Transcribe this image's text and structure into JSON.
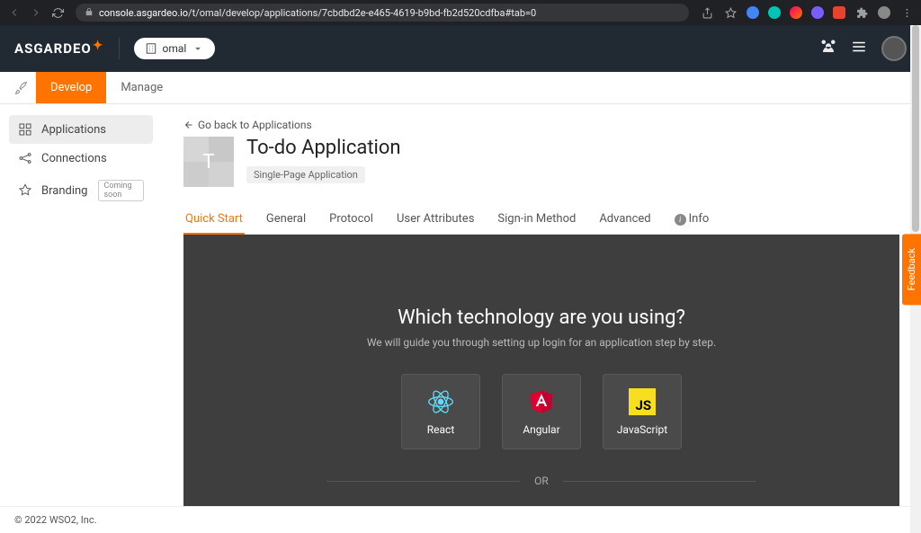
{
  "browser": {
    "url_domain": "console.asgardeo.io",
    "url_path": "/t/omal/develop/applications/7cbdbd2e-e465-4619-b9bd-fb2d520cdfba#tab=0"
  },
  "header": {
    "logo_text": "ASGARDEO",
    "org_name": "omal"
  },
  "main_tabs": {
    "develop": "Develop",
    "manage": "Manage"
  },
  "sidebar": {
    "items": [
      {
        "label": "Applications"
      },
      {
        "label": "Connections"
      },
      {
        "label": "Branding",
        "badge": "Coming soon"
      }
    ]
  },
  "page": {
    "back_link": "Go back to Applications",
    "app_initial": "T",
    "app_title": "To-do Application",
    "app_type": "Single-Page Application"
  },
  "detail_tabs": {
    "quick_start": "Quick Start",
    "general": "General",
    "protocol": "Protocol",
    "user_attributes": "User Attributes",
    "signin_method": "Sign-in Method",
    "advanced": "Advanced",
    "info": "Info"
  },
  "quickstart": {
    "heading": "Which technology are you using?",
    "subheading": "We will guide you through setting up login for an application step by step.",
    "techs": {
      "react": "React",
      "angular": "Angular",
      "javascript": "JavaScript"
    },
    "or": "OR"
  },
  "feedback": "Feedback",
  "footer": "© 2022 WSO2, Inc."
}
